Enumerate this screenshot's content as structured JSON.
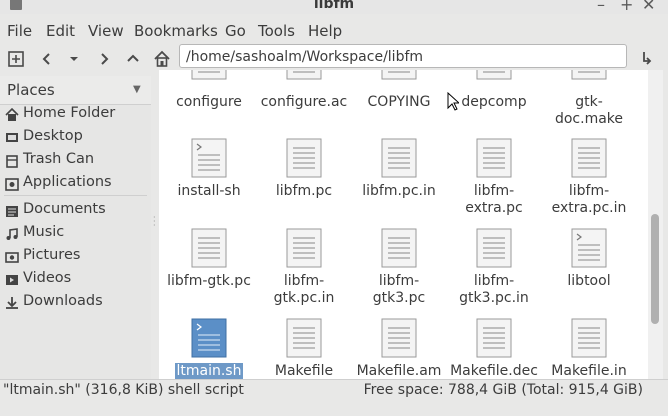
{
  "window": {
    "title": "libfm"
  },
  "menubar": {
    "items": [
      "File",
      "Edit",
      "View",
      "Bookmarks",
      "Go",
      "Tools",
      "Help"
    ]
  },
  "toolbar": {
    "path": "/home/sashoalm/Workspace/libfm"
  },
  "sidebar": {
    "header": "Places",
    "items": [
      {
        "label": "Home Folder",
        "icon": "home-icon"
      },
      {
        "label": "Desktop",
        "icon": "desktop-icon"
      },
      {
        "label": "Trash Can",
        "icon": "trash-icon"
      },
      {
        "label": "Applications",
        "icon": "applications-icon"
      },
      {
        "label": "Documents",
        "icon": "documents-icon"
      },
      {
        "label": "Music",
        "icon": "music-icon"
      },
      {
        "label": "Pictures",
        "icon": "pictures-icon"
      },
      {
        "label": "Videos",
        "icon": "videos-icon"
      },
      {
        "label": "Downloads",
        "icon": "downloads-icon"
      }
    ]
  },
  "files": [
    {
      "line1": "configure",
      "line2": ""
    },
    {
      "line1": "configure.ac",
      "line2": ""
    },
    {
      "line1": "COPYING",
      "line2": ""
    },
    {
      "line1": "depcomp",
      "line2": ""
    },
    {
      "line1": "gtk-",
      "line2": "doc.make"
    },
    {
      "line1": "install-sh",
      "line2": ""
    },
    {
      "line1": "libfm.pc",
      "line2": ""
    },
    {
      "line1": "libfm.pc.in",
      "line2": ""
    },
    {
      "line1": "libfm-",
      "line2": "extra.pc"
    },
    {
      "line1": "libfm-",
      "line2": "extra.pc.in"
    },
    {
      "line1": "libfm-gtk.pc",
      "line2": ""
    },
    {
      "line1": "libfm-",
      "line2": "gtk.pc.in"
    },
    {
      "line1": "libfm-",
      "line2": "gtk3.pc"
    },
    {
      "line1": "libfm-",
      "line2": "gtk3.pc.in"
    },
    {
      "line1": "libtool",
      "line2": ""
    },
    {
      "line1": "ltmain.sh",
      "line2": "",
      "selected": true
    },
    {
      "line1": "Makefile",
      "line2": ""
    },
    {
      "line1": "Makefile.am",
      "line2": ""
    },
    {
      "line1": "Makefile.dec",
      "line2": ""
    },
    {
      "line1": "Makefile.in",
      "line2": ""
    }
  ],
  "status": {
    "selection": "\"ltmain.sh\" (316,8 KiB) shell script",
    "free_space": "Free space: 788,4 GiB (Total: 915,4 GiB)"
  },
  "colors": {
    "selection": "#6e99c7",
    "accent_icon": "#5b8fc7"
  }
}
